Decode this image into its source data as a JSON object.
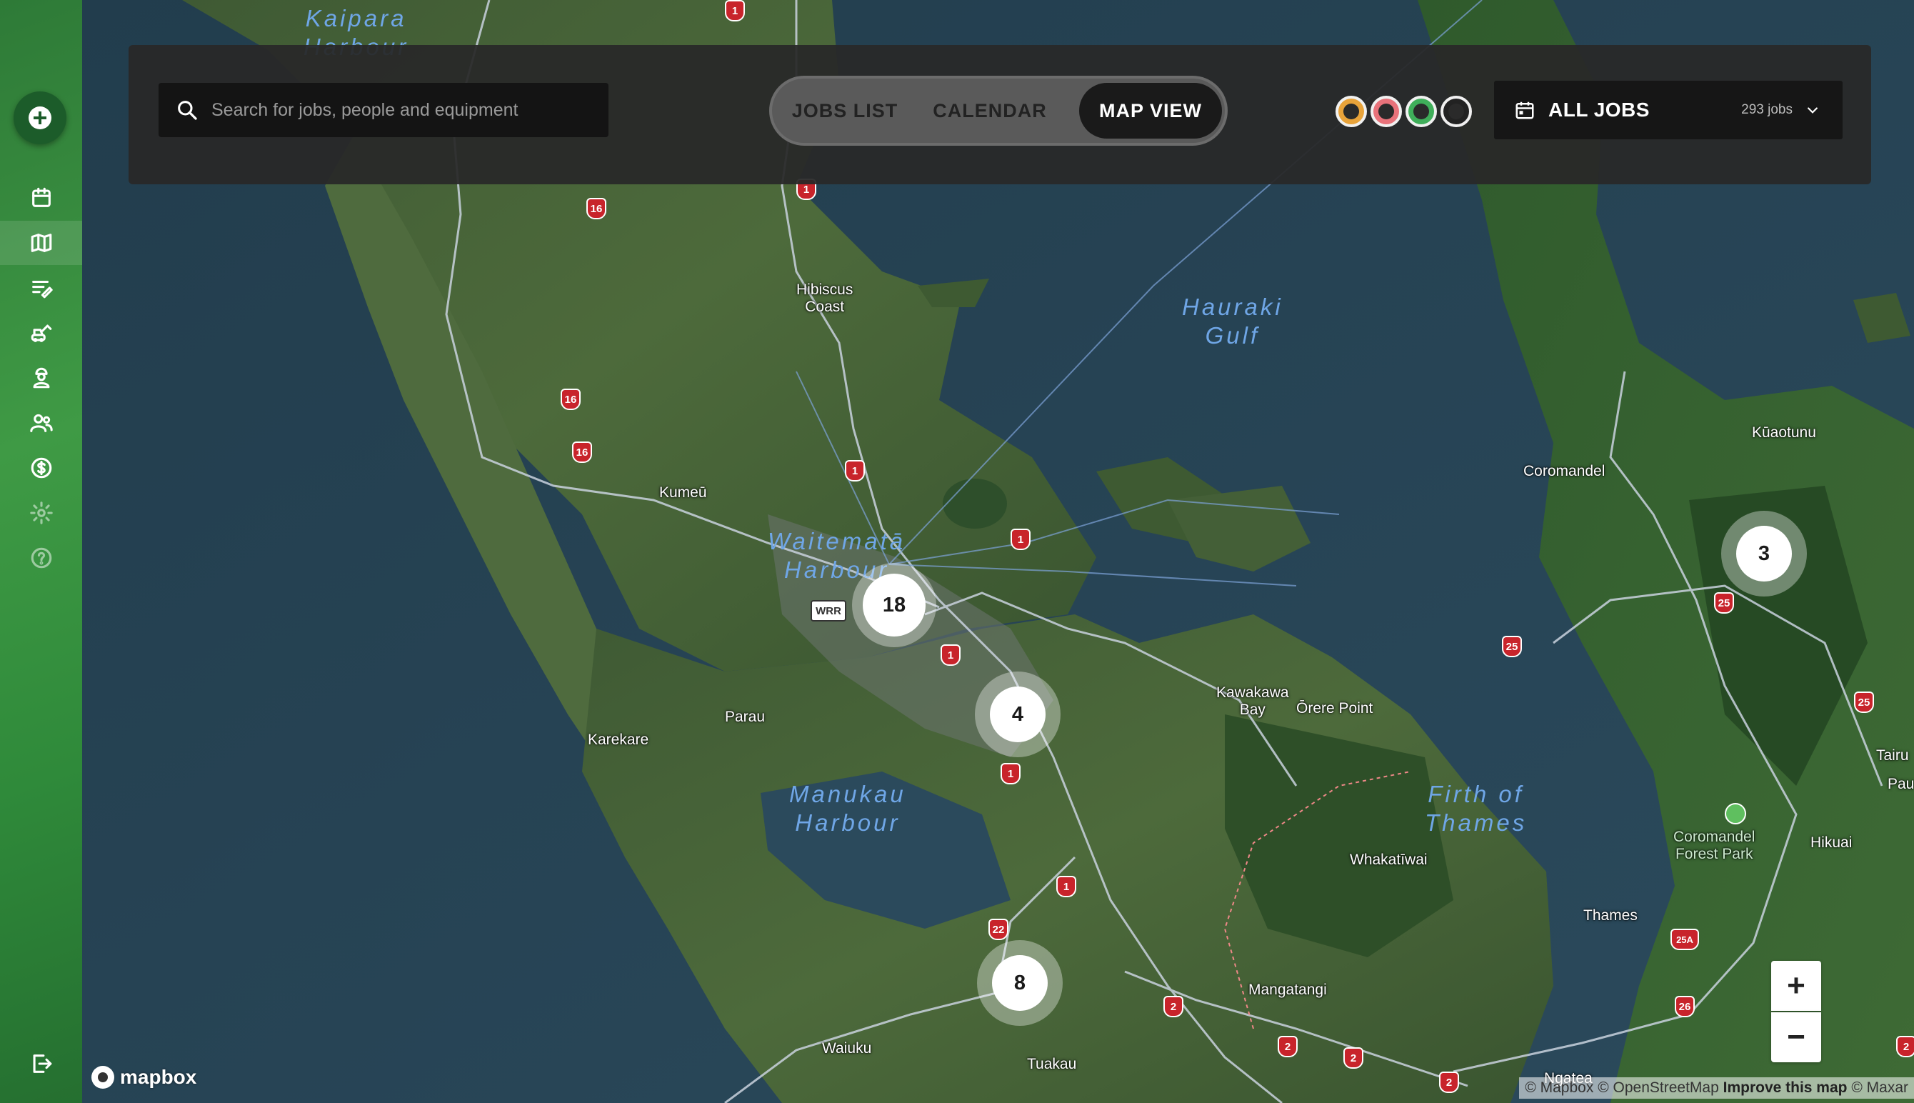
{
  "search": {
    "placeholder": "Search for jobs, people and equipment"
  },
  "view_tabs": [
    {
      "label": "JOBS LIST",
      "active": false
    },
    {
      "label": "CALENDAR",
      "active": false
    },
    {
      "label": "MAP VIEW",
      "active": true
    }
  ],
  "status_filters": [
    {
      "name": "status-orange",
      "color": "#e8a33a"
    },
    {
      "name": "status-pink",
      "color": "#e8727a"
    },
    {
      "name": "status-green",
      "color": "#3fae5a"
    },
    {
      "name": "status-black",
      "color": "#222222"
    }
  ],
  "job_filter": {
    "label": "ALL JOBS",
    "count": "293 jobs"
  },
  "map": {
    "places": {
      "hibiscus": "Hibiscus\nCoast",
      "kumeu": "Kumeū",
      "parau": "Parau",
      "karekare": "Karekare",
      "coromandel": "Coromandel",
      "kuaotunu": "Kūaotunu",
      "kawakawa": "Kawakawa\nBay",
      "orere": "Ōrere Point",
      "whakatiwai": "Whakatīwai",
      "thames": "Thames",
      "hikuai": "Hikuai",
      "mangatangi": "Mangatangi",
      "waiuku": "Waiuku",
      "tuakau": "Tuakau",
      "ngatea": "Ngatea",
      "tairu": "Tairu",
      "pau": "Pau",
      "forest": "Coromandel\nForest Park"
    },
    "water": {
      "kaipara": "Kaipara\nHarbour",
      "hauraki": "Hauraki\nGulf",
      "waitemata": "Waitematā\nHarbour",
      "manukau": "Manukau\nHarbour",
      "thames_firth": "Firth of\nThames"
    },
    "shields": [
      "1",
      "1",
      "1",
      "1",
      "1",
      "1",
      "1",
      "16",
      "16",
      "16",
      "22",
      "25",
      "25",
      "25",
      "25A",
      "26",
      "2",
      "2",
      "2",
      "2",
      "2",
      "WRR"
    ],
    "clusters": [
      {
        "id": "auckland",
        "count": "18"
      },
      {
        "id": "east",
        "count": "4"
      },
      {
        "id": "south",
        "count": "8"
      },
      {
        "id": "coromandel",
        "count": "3"
      }
    ],
    "zoom_in": "+",
    "zoom_out": "−",
    "brand": "mapbox",
    "attribution": {
      "mapbox": "© Mapbox",
      "osm": "© OpenStreetMap",
      "improve": "Improve this map",
      "maxar": "© Maxar"
    }
  },
  "nav": [
    {
      "name": "calendar"
    },
    {
      "name": "map",
      "active": true
    },
    {
      "name": "jobs"
    },
    {
      "name": "equipment"
    },
    {
      "name": "workers"
    },
    {
      "name": "clients"
    },
    {
      "name": "billing"
    },
    {
      "name": "settings"
    },
    {
      "name": "help"
    },
    {
      "name": "logout"
    }
  ]
}
